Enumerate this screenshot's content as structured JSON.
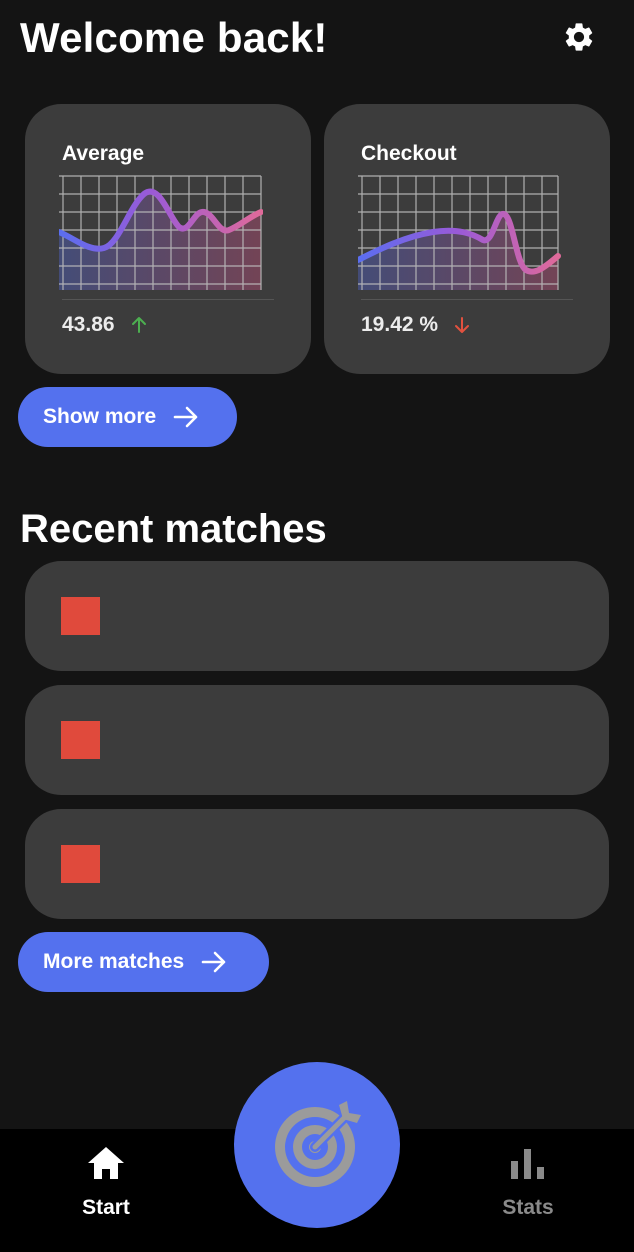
{
  "header": {
    "title": "Welcome back!",
    "settings_icon": "gear-icon"
  },
  "colors": {
    "background": "#141414",
    "card": "#3c3c3c",
    "accent": "#5471ee",
    "trend_up": "#4caf50",
    "trend_down": "#e2513f",
    "match_marker": "#e04a3c",
    "nav_bar": "#000000",
    "nav_inactive": "#8a8a8a"
  },
  "stats": [
    {
      "title": "Average",
      "value": "43.86",
      "trend": "up",
      "trend_icon": "arrow-up-icon"
    },
    {
      "title": "Checkout",
      "value": "19.42 %",
      "trend": "down",
      "trend_icon": "arrow-down-icon"
    }
  ],
  "show_more": {
    "label": "Show more",
    "icon": "arrow-right-icon"
  },
  "recent_matches": {
    "title": "Recent matches",
    "items": [
      {
        "marker_color": "#e04a3c"
      },
      {
        "marker_color": "#e04a3c"
      },
      {
        "marker_color": "#e04a3c"
      }
    ]
  },
  "more_matches": {
    "label": "More matches",
    "icon": "arrow-right-icon"
  },
  "bottom_nav": {
    "items": [
      {
        "label": "Start",
        "icon": "home-icon",
        "active": true
      },
      {
        "label": "Stats",
        "icon": "bar-chart-icon",
        "active": false
      }
    ],
    "fab_icon": "dartboard-target-icon"
  }
}
